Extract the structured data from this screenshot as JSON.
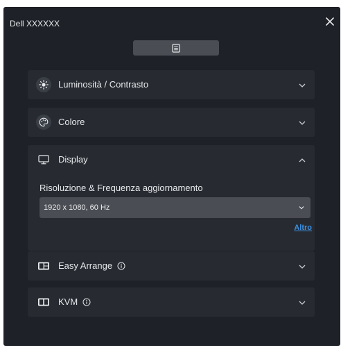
{
  "window": {
    "title": "Dell XXXXXX"
  },
  "panels": [
    {
      "label": "Luminosità / Contrasto",
      "icon": "brightness-icon",
      "expanded": false
    },
    {
      "label": "Colore",
      "icon": "color-palette-icon",
      "expanded": false
    },
    {
      "label": "Display",
      "icon": "monitor-icon",
      "expanded": true,
      "setting_label": "Risoluzione & Frequenza aggiornamento",
      "selected_value": "1920 x 1080, 60 Hz",
      "more_link": "Altro"
    },
    {
      "label": "Easy Arrange",
      "icon": "layout-icon",
      "info_icon": "info-icon",
      "expanded": false
    },
    {
      "label": "KVM",
      "icon": "kvm-icon",
      "info_icon": "info-icon",
      "expanded": false
    }
  ],
  "colors": {
    "background": "#1e2127",
    "panel": "#272b31",
    "control": "#4a4d53",
    "link": "#3d8fe0"
  }
}
